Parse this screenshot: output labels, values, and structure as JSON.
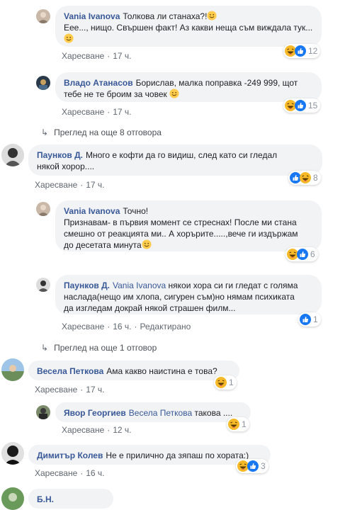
{
  "comments": [
    {
      "author": "Vania Ivanova",
      "text": "Толкова ли станаха?!",
      "text2": "Еее..., нищо. Свършен факт! Аз какви неща съм виждала тук...",
      "like": "Харесване",
      "time": "17 ч.",
      "count": "12"
    },
    {
      "author": "Владо Атанасов",
      "text": "Борислав, малка поправка -249 999, щот",
      "text2": "тебе не те броим за човек",
      "like": "Харесване",
      "time": "17 ч.",
      "count": "15"
    },
    {
      "more": "Преглед на още 8 отговора"
    },
    {
      "author": "Паунков Д.",
      "text": "Много е кофти да го видиш, след като си гледал",
      "text2": "някой хорор....",
      "like": "Харесване",
      "time": "17 ч.",
      "count": "8"
    },
    {
      "author": "Vania Ivanova",
      "text": "Точно!",
      "text2": "Признавам- в първия момент се стреснах! После ми стана",
      "text3": "смешно от реакцията ми.. А хорърите.....,вече ги издържам",
      "text4": "до десетата минута",
      "like": "Харесване",
      "time": "17 ч.",
      "count": "6"
    },
    {
      "author": "Паунков Д.",
      "mention": "Vania Ivanova",
      "text": "някои хора си ги гледат с голяма",
      "text2": "наслада(нещо им хлопа, сигурен съм)но нямам психиката",
      "text3": "да изгледам докрай някой страшен филм...",
      "like": "Харесване",
      "time": "16 ч.",
      "edited": "Редактирано",
      "count": "1"
    },
    {
      "more": "Преглед на още 1 отговор"
    },
    {
      "author": "Весела Петкова",
      "text": "Ама какво наистина е това?",
      "like": "Харесване",
      "time": "17 ч.",
      "count": "1"
    },
    {
      "author": "Явор Георгиев",
      "mention": "Весела Петкова",
      "text": "такова ....",
      "like": "Харесване",
      "time": "12 ч.",
      "count": "1"
    },
    {
      "author": "Димитър Колев",
      "text": "Не е прилично да зяпаш по хората:)",
      "like": "Харесване",
      "time": "16 ч.",
      "count": "3"
    },
    {
      "author": "Б.Н."
    }
  ],
  "colors": {
    "link": "#385898",
    "bubble": "#f2f3f5",
    "meta": "#606770",
    "like_blue": "#1877f2",
    "haha_yellow": "#f7b125"
  }
}
